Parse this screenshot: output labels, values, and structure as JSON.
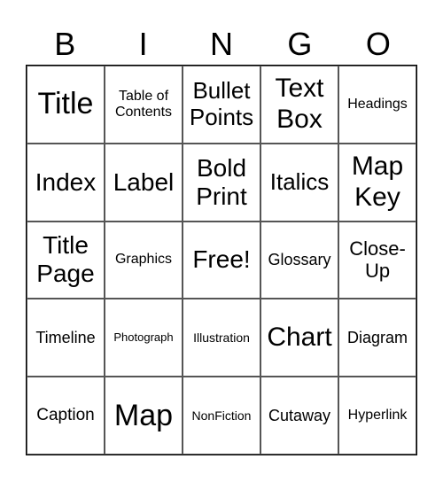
{
  "header": [
    "B",
    "I",
    "N",
    "G",
    "O"
  ],
  "cells": [
    "Title",
    "Table of Contents",
    "Bullet Points",
    "Text Box",
    "Headings",
    "Index",
    "Label",
    "Bold Print",
    "Italics",
    "Map Key",
    "Title Page",
    "Graphics",
    "Free!",
    "Glossary",
    "Close-Up",
    "Timeline",
    "Photograph",
    "Illustration",
    "Chart",
    "Diagram",
    "Caption",
    "Map",
    "NonFiction",
    "Cutaway",
    "Hyperlink"
  ]
}
